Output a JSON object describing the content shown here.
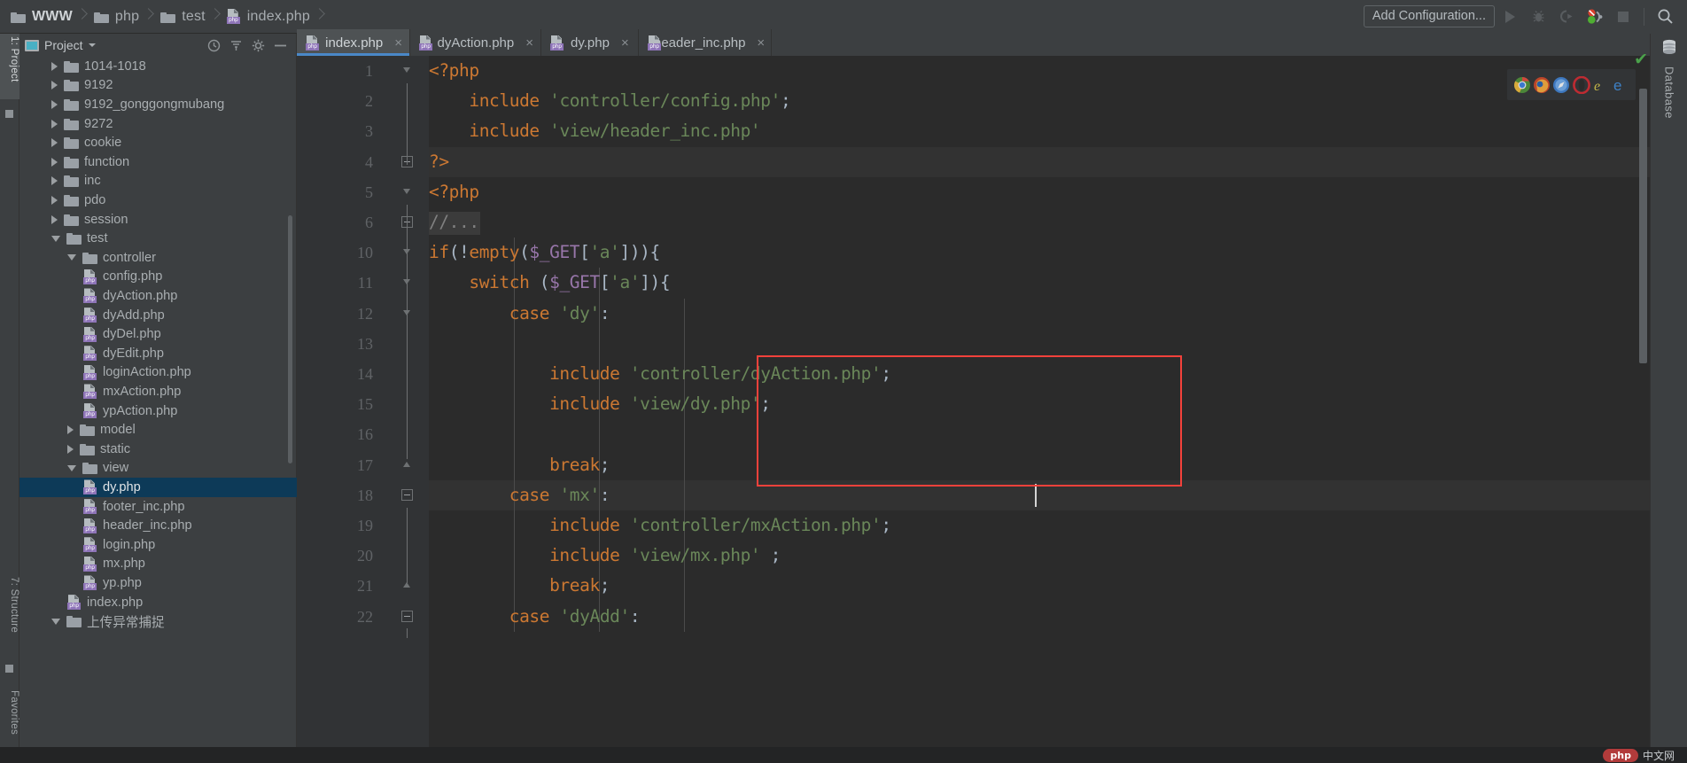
{
  "breadcrumb": [
    {
      "label": "WWW",
      "icon": "folder-icon"
    },
    {
      "label": "php",
      "icon": "folder-icon"
    },
    {
      "label": "test",
      "icon": "folder-icon"
    },
    {
      "label": "index.php",
      "icon": "php-file-icon"
    }
  ],
  "toolbar": {
    "add_configuration": "Add Configuration...",
    "run_icon": "run-icon",
    "debug_icon": "debug-icon",
    "run_coverage_icon": "run-with-coverage-icon",
    "profile_icon": "profile-icon",
    "stop_icon": "stop-icon",
    "search_icon": "search-everywhere-icon"
  },
  "left_rail": [
    {
      "label": "1: Project",
      "active": true
    },
    {
      "label": "7: Structure",
      "active": false
    },
    {
      "label": "Favorites",
      "active": false
    }
  ],
  "project_panel": {
    "title": "Project",
    "caret_icon": "chevron-down-icon",
    "actions": [
      {
        "name": "locate-icon"
      },
      {
        "name": "collapse-all-icon"
      },
      {
        "name": "settings-gear-icon"
      },
      {
        "name": "hide-icon"
      }
    ]
  },
  "tree": [
    {
      "label": "1014-1018",
      "depth": 1,
      "type": "folder",
      "state": "collapsed"
    },
    {
      "label": "9192",
      "depth": 1,
      "type": "folder",
      "state": "collapsed"
    },
    {
      "label": "9192_gonggongmubang",
      "depth": 1,
      "type": "folder",
      "state": "collapsed"
    },
    {
      "label": "9272",
      "depth": 1,
      "type": "folder",
      "state": "collapsed"
    },
    {
      "label": "cookie",
      "depth": 1,
      "type": "folder",
      "state": "collapsed"
    },
    {
      "label": "function",
      "depth": 1,
      "type": "folder",
      "state": "collapsed"
    },
    {
      "label": "inc",
      "depth": 1,
      "type": "folder",
      "state": "collapsed"
    },
    {
      "label": "pdo",
      "depth": 1,
      "type": "folder",
      "state": "collapsed"
    },
    {
      "label": "session",
      "depth": 1,
      "type": "folder",
      "state": "collapsed"
    },
    {
      "label": "test",
      "depth": 1,
      "type": "folder",
      "state": "expanded"
    },
    {
      "label": "controller",
      "depth": 2,
      "type": "folder",
      "state": "expanded"
    },
    {
      "label": "config.php",
      "depth": 3,
      "type": "php"
    },
    {
      "label": "dyAction.php",
      "depth": 3,
      "type": "php"
    },
    {
      "label": "dyAdd.php",
      "depth": 3,
      "type": "php"
    },
    {
      "label": "dyDel.php",
      "depth": 3,
      "type": "php"
    },
    {
      "label": "dyEdit.php",
      "depth": 3,
      "type": "php"
    },
    {
      "label": "loginAction.php",
      "depth": 3,
      "type": "php"
    },
    {
      "label": "mxAction.php",
      "depth": 3,
      "type": "php"
    },
    {
      "label": "ypAction.php",
      "depth": 3,
      "type": "php"
    },
    {
      "label": "model",
      "depth": 2,
      "type": "folder",
      "state": "collapsed"
    },
    {
      "label": "static",
      "depth": 2,
      "type": "folder",
      "state": "collapsed"
    },
    {
      "label": "view",
      "depth": 2,
      "type": "folder",
      "state": "expanded"
    },
    {
      "label": "dy.php",
      "depth": 3,
      "type": "php",
      "selected": true
    },
    {
      "label": "footer_inc.php",
      "depth": 3,
      "type": "php"
    },
    {
      "label": "header_inc.php",
      "depth": 3,
      "type": "php"
    },
    {
      "label": "login.php",
      "depth": 3,
      "type": "php"
    },
    {
      "label": "mx.php",
      "depth": 3,
      "type": "php"
    },
    {
      "label": "yp.php",
      "depth": 3,
      "type": "php"
    },
    {
      "label": "index.php",
      "depth": 2,
      "type": "php"
    },
    {
      "label": "上传异常捕捉",
      "depth": 1,
      "type": "folder",
      "state": "expanded"
    }
  ],
  "editor_tabs": [
    {
      "label": "index.php",
      "active": true,
      "close": "×"
    },
    {
      "label": "dyAction.php",
      "active": false,
      "close": "×"
    },
    {
      "label": "dy.php",
      "active": false,
      "close": "×"
    },
    {
      "label": "header_inc.php",
      "active": false,
      "close": "×"
    }
  ],
  "code": {
    "line_numbers": [
      "1",
      "2",
      "3",
      "4",
      "5",
      "6",
      "10",
      "11",
      "12",
      "13",
      "14",
      "15",
      "16",
      "17",
      "18",
      "19",
      "20",
      "21",
      "22"
    ],
    "lines": [
      {
        "num": "1",
        "tokens": [
          {
            "t": "<?php",
            "c": "k"
          }
        ]
      },
      {
        "num": "2",
        "tokens": [
          {
            "t": "    ",
            "c": "p"
          },
          {
            "t": "include",
            "c": "k"
          },
          {
            "t": " ",
            "c": "p"
          },
          {
            "t": "'controller/config.php'",
            "c": "s"
          },
          {
            "t": ";",
            "c": "p"
          }
        ]
      },
      {
        "num": "3",
        "tokens": [
          {
            "t": "    ",
            "c": "p"
          },
          {
            "t": "include",
            "c": "k"
          },
          {
            "t": " ",
            "c": "p"
          },
          {
            "t": "'view/header_inc.php'",
            "c": "s"
          }
        ]
      },
      {
        "num": "4",
        "tokens": [
          {
            "t": "?>",
            "c": "k"
          }
        ]
      },
      {
        "num": "5",
        "tokens": [
          {
            "t": "<?php",
            "c": "k"
          }
        ]
      },
      {
        "num": "6",
        "tokens": [
          {
            "t": "//...",
            "c": "cm"
          }
        ]
      },
      {
        "num": "10",
        "tokens": [
          {
            "t": "if",
            "c": "k"
          },
          {
            "t": "(!",
            "c": "p"
          },
          {
            "t": "empty",
            "c": "k"
          },
          {
            "t": "(",
            "c": "p"
          },
          {
            "t": "$_GET",
            "c": "v"
          },
          {
            "t": "[",
            "c": "p"
          },
          {
            "t": "'a'",
            "c": "s"
          },
          {
            "t": "])){",
            "c": "p"
          }
        ]
      },
      {
        "num": "11",
        "tokens": [
          {
            "t": "    ",
            "c": "p"
          },
          {
            "t": "switch",
            "c": "k"
          },
          {
            "t": " (",
            "c": "p"
          },
          {
            "t": "$_GET",
            "c": "v"
          },
          {
            "t": "[",
            "c": "p"
          },
          {
            "t": "'a'",
            "c": "s"
          },
          {
            "t": "]){",
            "c": "p"
          }
        ]
      },
      {
        "num": "12",
        "tokens": [
          {
            "t": "        ",
            "c": "p"
          },
          {
            "t": "case",
            "c": "k"
          },
          {
            "t": " ",
            "c": "p"
          },
          {
            "t": "'dy'",
            "c": "s"
          },
          {
            "t": ":",
            "c": "p"
          }
        ]
      },
      {
        "num": "13",
        "tokens": []
      },
      {
        "num": "14",
        "tokens": [
          {
            "t": "            ",
            "c": "p"
          },
          {
            "t": "include",
            "c": "k"
          },
          {
            "t": " ",
            "c": "p"
          },
          {
            "t": "'controller/dyAction.php'",
            "c": "s"
          },
          {
            "t": ";",
            "c": "p"
          }
        ]
      },
      {
        "num": "15",
        "tokens": [
          {
            "t": "            ",
            "c": "p"
          },
          {
            "t": "include",
            "c": "k"
          },
          {
            "t": " ",
            "c": "p"
          },
          {
            "t": "'view/dy.php'",
            "c": "s"
          },
          {
            "t": ";",
            "c": "p"
          }
        ]
      },
      {
        "num": "16",
        "tokens": []
      },
      {
        "num": "17",
        "tokens": [
          {
            "t": "            ",
            "c": "p"
          },
          {
            "t": "break",
            "c": "k"
          },
          {
            "t": ";",
            "c": "p"
          }
        ]
      },
      {
        "num": "18",
        "tokens": [
          {
            "t": "        ",
            "c": "p"
          },
          {
            "t": "case",
            "c": "k"
          },
          {
            "t": " ",
            "c": "p"
          },
          {
            "t": "'mx'",
            "c": "s"
          },
          {
            "t": ":",
            "c": "p"
          }
        ]
      },
      {
        "num": "19",
        "tokens": [
          {
            "t": "            ",
            "c": "p"
          },
          {
            "t": "include",
            "c": "k"
          },
          {
            "t": " ",
            "c": "p"
          },
          {
            "t": "'controller/mxAction.php'",
            "c": "s"
          },
          {
            "t": ";",
            "c": "p"
          }
        ]
      },
      {
        "num": "20",
        "tokens": [
          {
            "t": "            ",
            "c": "p"
          },
          {
            "t": "include",
            "c": "k"
          },
          {
            "t": " ",
            "c": "p"
          },
          {
            "t": "'view/mx.php'",
            "c": "s"
          },
          {
            "t": " ;",
            "c": "p"
          }
        ]
      },
      {
        "num": "21",
        "tokens": [
          {
            "t": "            ",
            "c": "p"
          },
          {
            "t": "break",
            "c": "k"
          },
          {
            "t": ";",
            "c": "p"
          }
        ]
      },
      {
        "num": "22",
        "tokens": [
          {
            "t": "        ",
            "c": "p"
          },
          {
            "t": "case",
            "c": "k"
          },
          {
            "t": " ",
            "c": "p"
          },
          {
            "t": "'dyAdd'",
            "c": "s"
          },
          {
            "t": ":",
            "c": "p"
          }
        ]
      }
    ],
    "colors": {
      "keyword": "#cc7832",
      "string": "#6a8759",
      "variable": "#9876aa",
      "plain": "#a9b7c6",
      "comment": "#808080",
      "background": "#2b2b2b",
      "gutter": "#313335",
      "annotation_box": "#f4413b"
    },
    "annotation": {
      "name": "red-highlight-box"
    },
    "caret_line": "15"
  },
  "browser_bar": [
    {
      "name": "chrome-icon"
    },
    {
      "name": "firefox-icon"
    },
    {
      "name": "safari-icon"
    },
    {
      "name": "opera-icon"
    },
    {
      "name": "internet-explorer-icon"
    },
    {
      "name": "edge-icon"
    }
  ],
  "inspection_status": {
    "icon": "checkmark-icon",
    "glyph": "✔",
    "color": "#4ba14b"
  },
  "right_rail": {
    "label": "Database",
    "icon": "database-icon"
  },
  "status_bar": {
    "watermark_php": "php",
    "watermark_cn": "中文网"
  }
}
